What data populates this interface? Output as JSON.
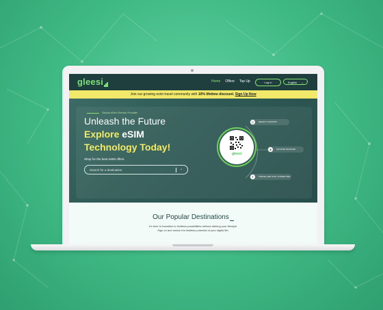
{
  "nav": {
    "logo_text": "gleesi",
    "links": [
      "Home",
      "Offers",
      "Top Up"
    ],
    "login_label": "Log in",
    "language_label": "English"
  },
  "banner": {
    "prefix": "Join our growing esim travel community with ",
    "highlight": "10% lifetime discount.",
    "cta": "Sign Up Now"
  },
  "hero": {
    "eyebrow": "Global eSim Service Provider",
    "headline_line1": "Unleash the Future",
    "headline_line2_prefix": "Explore ",
    "headline_line2_highlight": "eSIM",
    "headline_line3": "Technology Today!",
    "shop_label": "Shop for the best eSIM offers",
    "search_placeholder": "Search for a destination",
    "qr_logo_text": "gleesi",
    "steps": [
      "SELECT COUNTRY",
      "CHOOSE PACKAGE",
      "TRAVEL AND STAY CONNECTED"
    ]
  },
  "section": {
    "title_prefix": "Our Popular ",
    "title_highlight": "Destinations",
    "subtitle_line1": "It's time to transition to limitless possibilities without altering your lifestyle.",
    "subtitle_line2": "Sign on and unlock the limitless potential of your digital life."
  },
  "colors": {
    "background": "#3fb984",
    "nav_bg": "#1f3f3e",
    "brand_green": "#8be46f",
    "banner_yellow": "#f2e96a",
    "headline_yellow": "#f4ec63"
  }
}
